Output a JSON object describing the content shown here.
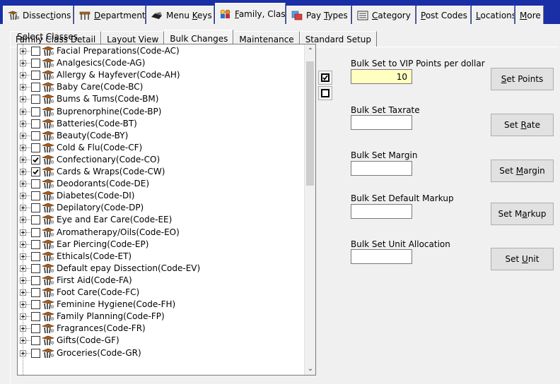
{
  "top_tabs": [
    {
      "pre": "Dissec",
      "ul": "t",
      "post": "ions",
      "icon": "dissection-icon",
      "active": false
    },
    {
      "pre": "",
      "ul": "D",
      "post": "epartments",
      "icon": "departments-icon",
      "active": false
    },
    {
      "pre": "Menu ",
      "ul": "K",
      "post": "eys",
      "icon": "menu-keys-icon",
      "active": false
    },
    {
      "pre": "",
      "ul": "F",
      "post": "amily, Class",
      "icon": "family-class-icon",
      "active": true
    },
    {
      "pre": "Pay ",
      "ul": "T",
      "post": "ypes",
      "icon": "pay-types-icon",
      "active": false
    },
    {
      "pre": "",
      "ul": "C",
      "post": "ategory",
      "icon": "category-icon",
      "active": false
    },
    {
      "pre": "",
      "ul": "P",
      "post": "ost Codes",
      "icon": "",
      "active": false
    },
    {
      "pre": "",
      "ul": "L",
      "post": "ocations",
      "icon": "",
      "active": false
    },
    {
      "pre": "",
      "ul": "M",
      "post": "ore",
      "icon": "",
      "active": false
    }
  ],
  "sub_tabs": [
    "Family Class Detail",
    "Layout View",
    "Bulk Changes",
    "Maintenance",
    "Standard Setup"
  ],
  "select_classes_label": "Select Classes",
  "classes": [
    {
      "label": "Facial Preparations(Code-AC)",
      "checked": false
    },
    {
      "label": "Analgesics(Code-AG)",
      "checked": false
    },
    {
      "label": "Allergy & Hayfever(Code-AH)",
      "checked": false
    },
    {
      "label": "Baby Care(Code-BC)",
      "checked": false
    },
    {
      "label": "Bums & Tums(Code-BM)",
      "checked": false
    },
    {
      "label": "Buprenorphine(Code-BP)",
      "checked": false
    },
    {
      "label": "Batteries(Code-BT)",
      "checked": false
    },
    {
      "label": "Beauty(Code-BY)",
      "checked": false
    },
    {
      "label": "Cold & Flu(Code-CF)",
      "checked": false
    },
    {
      "label": "Confectionary(Code-CO)",
      "checked": true
    },
    {
      "label": "Cards & Wraps(Code-CW)",
      "checked": true
    },
    {
      "label": "Deodorants(Code-DE)",
      "checked": false
    },
    {
      "label": "Diabetes(Code-DI)",
      "checked": false
    },
    {
      "label": "Depilatory(Code-DP)",
      "checked": false
    },
    {
      "label": "Eye and Ear Care(Code-EE)",
      "checked": false
    },
    {
      "label": "Aromatherapy/Oils(Code-EO)",
      "checked": false
    },
    {
      "label": "Ear Piercing(Code-EP)",
      "checked": false
    },
    {
      "label": "Ethicals(Code-ET)",
      "checked": false
    },
    {
      "label": "Default epay Dissection(Code-EV)",
      "checked": false
    },
    {
      "label": "First Aid(Code-FA)",
      "checked": false
    },
    {
      "label": "Foot Care(Code-FC)",
      "checked": false
    },
    {
      "label": "Feminine Hygiene(Code-FH)",
      "checked": false
    },
    {
      "label": "Family Planning(Code-FP)",
      "checked": false
    },
    {
      "label": "Fragrances(Code-FR)",
      "checked": false
    },
    {
      "label": "Gifts(Code-GF)",
      "checked": false
    },
    {
      "label": "Groceries(Code-GR)",
      "checked": false
    }
  ],
  "fields": [
    {
      "label": "Bulk Set to VIP Points per dollar",
      "value": "10",
      "highlight": true,
      "btn_pre": "",
      "btn_ul": "S",
      "btn_post": "et Points"
    },
    {
      "label": "Bulk Set Taxrate",
      "value": "",
      "highlight": false,
      "btn_pre": "Set ",
      "btn_ul": "R",
      "btn_post": "ate"
    },
    {
      "label": "Bulk Set Margin",
      "value": "",
      "highlight": false,
      "btn_pre": "Set ",
      "btn_ul": "M",
      "btn_post": "argin"
    },
    {
      "label": "Bulk Set Default Markup",
      "value": "",
      "highlight": false,
      "btn_pre": "Set M",
      "btn_ul": "a",
      "btn_post": "rkup"
    },
    {
      "label": "Bulk Set Unit Allocation",
      "value": "",
      "highlight": false,
      "btn_pre": "Set ",
      "btn_ul": "U",
      "btn_post": "nit"
    }
  ]
}
